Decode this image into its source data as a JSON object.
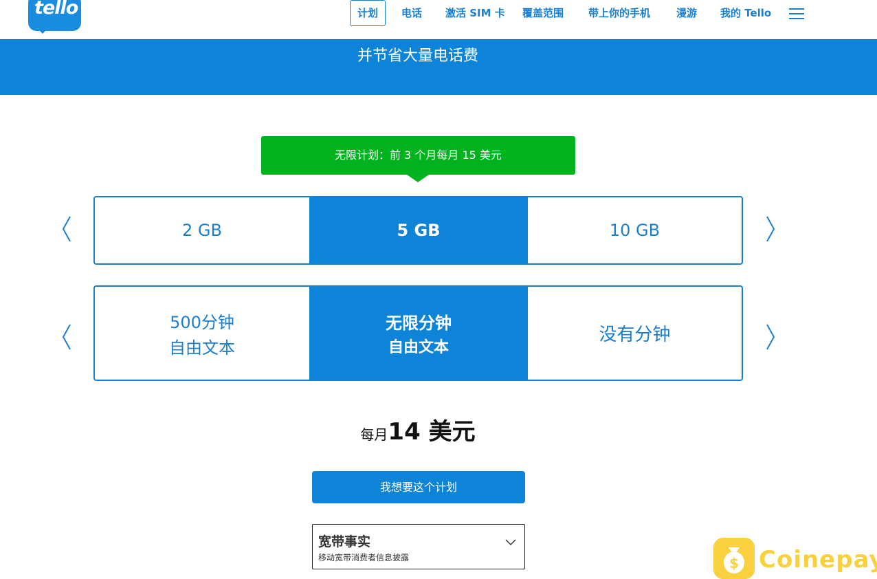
{
  "header": {
    "logo_text": "tello",
    "nav": [
      "计划",
      "电话",
      "激活 SIM 卡",
      "覆盖范围",
      "带上你的手机",
      "漫游",
      "我的 Tello"
    ],
    "active_nav": "计划",
    "menu_icon": "hamburger-icon"
  },
  "hero": {
    "subtitle": "并节省大量电话费"
  },
  "promo": {
    "text": "无限计划：前 3 个月每月 15 美元"
  },
  "data_selector": {
    "options": [
      "2 GB",
      "5 GB",
      "10 GB"
    ],
    "selected": "5 GB",
    "prev_icon": "chevron-left-icon",
    "next_icon": "chevron-right-icon"
  },
  "minutes_selector": {
    "options": [
      {
        "line1": "500分钟",
        "line2": "自由文本"
      },
      {
        "line1": "无限分钟",
        "line2": "自由文本"
      },
      {
        "line1": "没有分钟",
        "line2": ""
      }
    ],
    "selected": "无限分钟"
  },
  "price": {
    "per": "每月",
    "amount": "14 美元"
  },
  "cta": {
    "label": "我想要这个计划"
  },
  "broadband": {
    "title": "宽带事实",
    "subtitle": "移动宽带消费者信息披露",
    "icon": "chevron-down-icon"
  },
  "watermark": {
    "text": "Coinepay",
    "icon": "money-bag-icon"
  },
  "colors": {
    "brand": "#0e84d8",
    "promo": "#00b31e",
    "watermark": "#f9d13e"
  }
}
